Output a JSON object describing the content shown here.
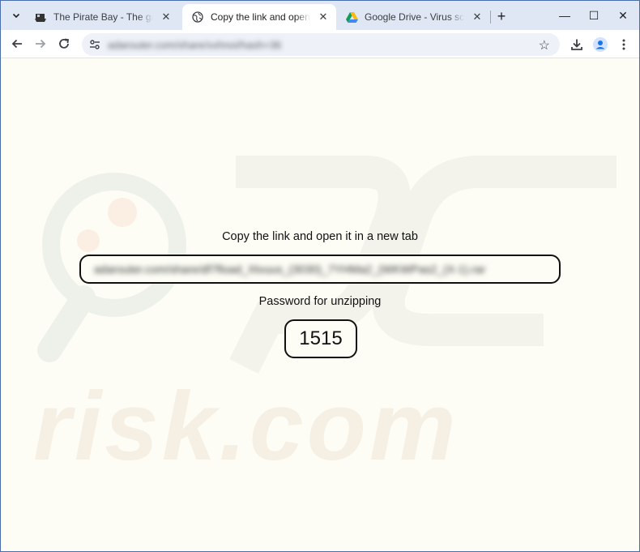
{
  "browser": {
    "tabs": [
      {
        "title": "The Pirate Bay - The galaxy's most resilient BitTorrent site",
        "active": false,
        "icon": "pirate-ship-icon"
      },
      {
        "title": "Copy the link and open it in a new tab",
        "active": true,
        "icon": "globe-icon"
      },
      {
        "title": "Google Drive - Virus scan warning",
        "active": false,
        "icon": "google-drive-icon"
      }
    ],
    "url": "adarouter.com/share/xxhnoi/hash=36",
    "new_tab_symbol": "+",
    "window_controls": {
      "minimize": "—",
      "maximize": "☐",
      "close": "✕"
    }
  },
  "page": {
    "instruction": "Copy the link and open it in a new tab",
    "link_value": "adarouter.com/share/df7fload_Xtvuus_(3030)_7YHMa2_(WKWPas2_(X-1).rar",
    "password_label": "Password for unzipping",
    "password_value": "1515"
  },
  "watermark": {
    "text": "risk.com",
    "color": "#f4ece0"
  },
  "colors": {
    "accent": "#1a73e8",
    "tabstrip": "#dfe7f5",
    "page_bg": "#fdfdf6"
  }
}
